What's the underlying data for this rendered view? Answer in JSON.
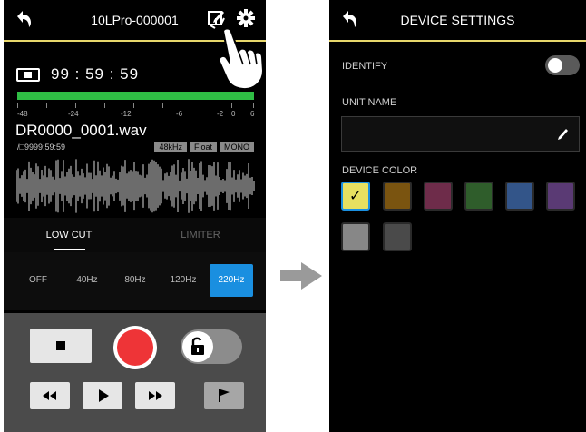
{
  "left_screen": {
    "title": "10LPro-000001",
    "icons": [
      "back-arrow-icon",
      "edit-icon",
      "gear-icon"
    ],
    "time": "99 : 59 : 59",
    "level_meter_fill": 1.0,
    "meter_scale": [
      "-48",
      "-24",
      "-12",
      "-6",
      "-2",
      "0",
      "6"
    ],
    "filename": "DR0000_0001.wav",
    "remaining": "9999:59:59",
    "badges": [
      "48kHz",
      "Float",
      "MONO"
    ],
    "tabs": {
      "low_cut": "LOW CUT",
      "limiter": "LIMITER"
    },
    "freq_options": [
      "OFF",
      "40Hz",
      "80Hz",
      "120Hz",
      "220Hz"
    ],
    "freq_selected": "220Hz",
    "transport_icons": [
      "stop-icon",
      "record-icon",
      "lock-icon",
      "rewind-icon",
      "play-icon",
      "fast-forward-icon",
      "mark-flag-icon"
    ]
  },
  "right_screen": {
    "title": "DEVICE SETTINGS",
    "identify_label": "IDENTIFY",
    "unit_name_label": "UNIT NAME",
    "unit_name_value": "",
    "device_color_label": "DEVICE COLOR",
    "colors": [
      "#e7e060",
      "#7a5410",
      "#6e2c4a",
      "#2f5d2b",
      "#335589",
      "#5a3a74",
      "#878787",
      "#4a4a4a"
    ],
    "selected_color": "#e7e060"
  },
  "accent": "#1a8fe0",
  "meter_color": "#2fbd44",
  "record_color": "#ee3437"
}
